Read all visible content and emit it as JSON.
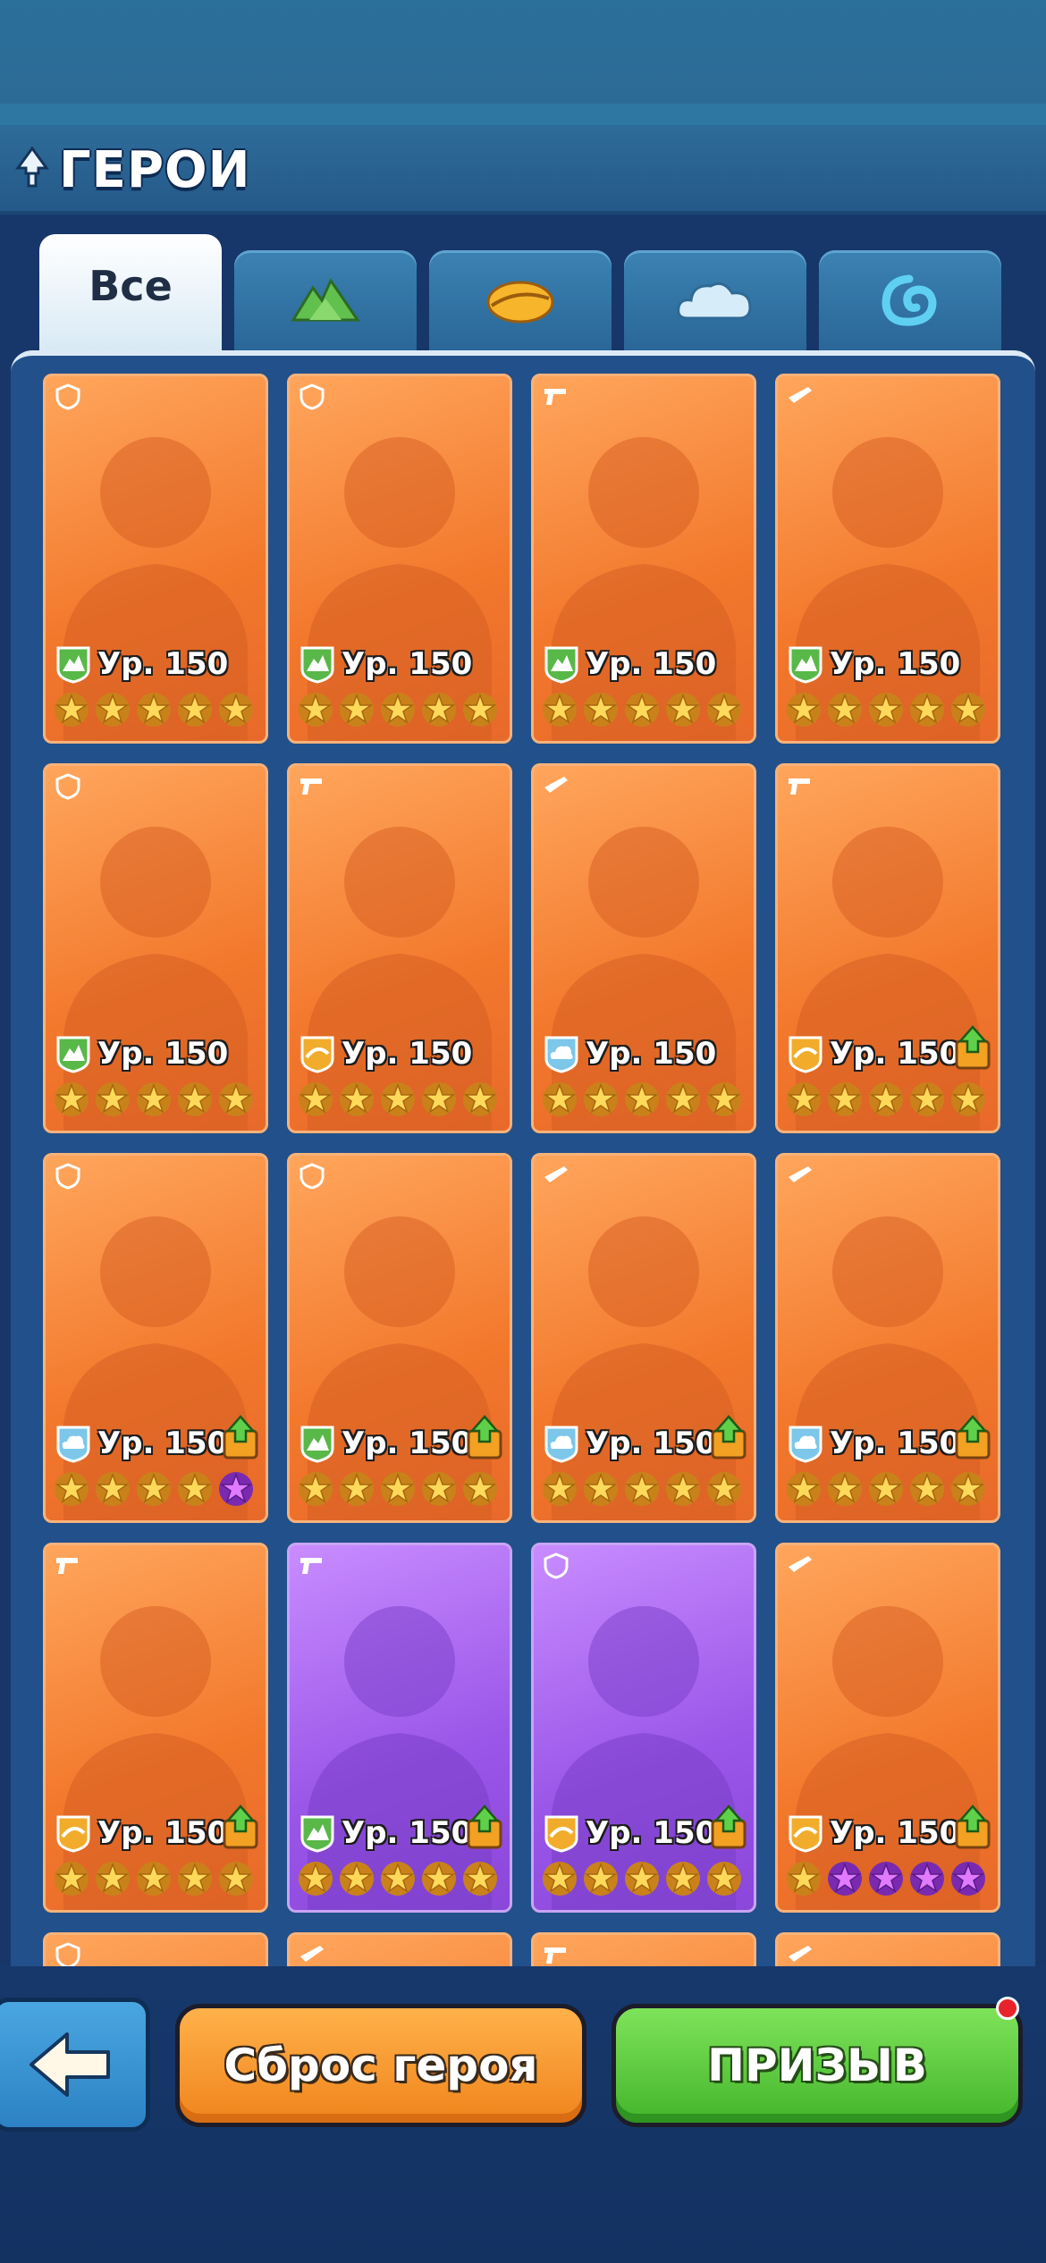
{
  "header": {
    "title": "ГЕРОИ",
    "icon": "tree-icon"
  },
  "tabs": [
    {
      "label": "Все",
      "icon": null,
      "active": true
    },
    {
      "label": "",
      "icon": "mountain-icon",
      "active": false
    },
    {
      "label": "",
      "icon": "sand-icon",
      "active": false
    },
    {
      "label": "",
      "icon": "cloud-icon",
      "active": false
    },
    {
      "label": "",
      "icon": "water-icon",
      "active": false
    }
  ],
  "heroes": [
    {
      "level": "Ур. 150",
      "element": "mountain",
      "role": "shield",
      "rarity": "orange",
      "stars": [
        "gold",
        "gold",
        "gold",
        "gold",
        "gold"
      ],
      "upgrade": false
    },
    {
      "level": "Ур. 150",
      "element": "mountain",
      "role": "shield",
      "rarity": "orange",
      "stars": [
        "gold",
        "gold",
        "gold",
        "gold",
        "gold"
      ],
      "upgrade": false
    },
    {
      "level": "Ур. 150",
      "element": "mountain",
      "role": "gun",
      "rarity": "orange",
      "stars": [
        "gold",
        "gold",
        "gold",
        "gold",
        "gold"
      ],
      "upgrade": false
    },
    {
      "level": "Ур. 150",
      "element": "mountain",
      "role": "rifle",
      "rarity": "orange",
      "stars": [
        "gold",
        "gold",
        "gold",
        "gold",
        "gold"
      ],
      "upgrade": false
    },
    {
      "level": "Ур. 150",
      "element": "mountain",
      "role": "shield",
      "rarity": "orange",
      "stars": [
        "gold",
        "gold",
        "gold",
        "gold",
        "gold"
      ],
      "upgrade": false
    },
    {
      "level": "Ур. 150",
      "element": "sand",
      "role": "gun",
      "rarity": "orange",
      "stars": [
        "gold",
        "gold",
        "gold",
        "gold",
        "gold"
      ],
      "upgrade": false
    },
    {
      "level": "Ур. 150",
      "element": "cloud",
      "role": "rifle",
      "rarity": "orange",
      "stars": [
        "gold",
        "gold",
        "gold",
        "gold",
        "gold"
      ],
      "upgrade": false
    },
    {
      "level": "Ур. 150",
      "element": "sand",
      "role": "gun",
      "rarity": "orange",
      "stars": [
        "gold",
        "gold",
        "gold",
        "gold",
        "gold"
      ],
      "upgrade": true
    },
    {
      "level": "Ур. 150",
      "element": "cloud",
      "role": "shield",
      "rarity": "orange",
      "stars": [
        "gold",
        "gold",
        "gold",
        "gold",
        "purple"
      ],
      "upgrade": true
    },
    {
      "level": "Ур. 150",
      "element": "mountain",
      "role": "shield",
      "rarity": "orange",
      "stars": [
        "gold",
        "gold",
        "gold",
        "gold",
        "gold"
      ],
      "upgrade": true
    },
    {
      "level": "Ур. 150",
      "element": "cloud",
      "role": "rifle",
      "rarity": "orange",
      "stars": [
        "gold",
        "gold",
        "gold",
        "gold",
        "gold"
      ],
      "upgrade": true
    },
    {
      "level": "Ур. 150",
      "element": "cloud",
      "role": "rifle",
      "rarity": "orange",
      "stars": [
        "gold",
        "gold",
        "gold",
        "gold",
        "gold"
      ],
      "upgrade": true
    },
    {
      "level": "Ур. 150",
      "element": "sand",
      "role": "gun",
      "rarity": "orange",
      "stars": [
        "gold",
        "gold",
        "gold",
        "gold",
        "gold"
      ],
      "upgrade": true
    },
    {
      "level": "Ур. 150",
      "element": "mountain",
      "role": "gun",
      "rarity": "purple",
      "stars": [
        "gold",
        "gold",
        "gold",
        "gold",
        "gold"
      ],
      "upgrade": true
    },
    {
      "level": "Ур. 150",
      "element": "sand",
      "role": "shield",
      "rarity": "purple",
      "stars": [
        "gold",
        "gold",
        "gold",
        "gold",
        "gold"
      ],
      "upgrade": true
    },
    {
      "level": "Ур. 150",
      "element": "sand",
      "role": "rifle",
      "rarity": "orange",
      "stars": [
        "gold",
        "purple",
        "purple",
        "purple",
        "purple"
      ],
      "upgrade": true
    }
  ],
  "footer": {
    "back_icon": "back-arrow-icon",
    "reset_label": "Сброс героя",
    "summon_label": "ПРИЗЫВ",
    "summon_notification": true
  },
  "colors": {
    "orange_card": "#f2782c",
    "purple_card": "#9a56e8",
    "gold_star": "#f5c23a",
    "purple_star": "#c34cf2",
    "mountain": "#58b848",
    "sand": "#f2ac2b",
    "cloud": "#7cc7ea"
  }
}
